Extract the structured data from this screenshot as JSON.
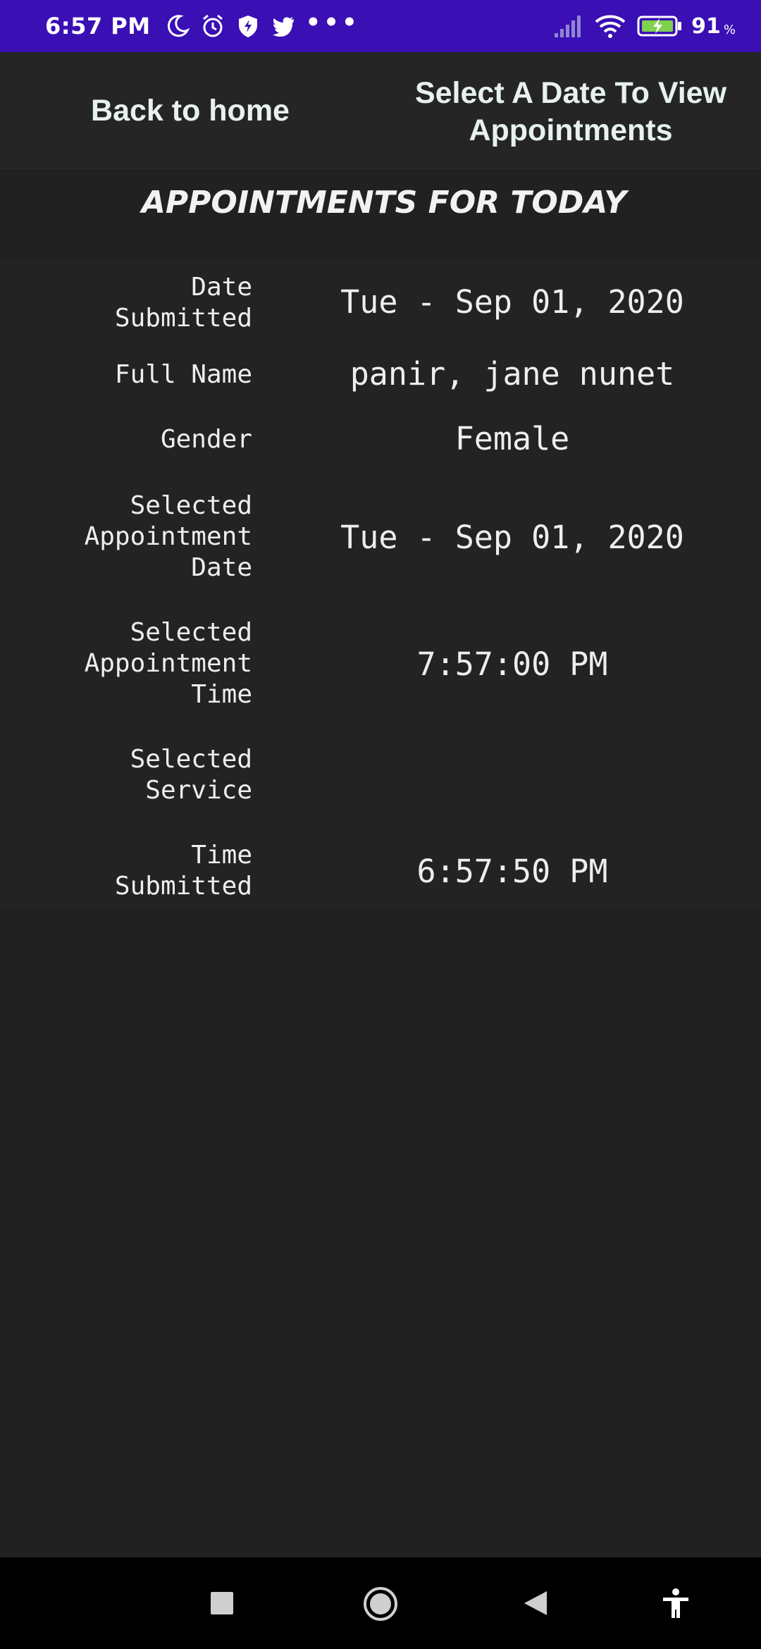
{
  "status_bar": {
    "time": "6:57 PM",
    "left_icons": [
      "moon-icon",
      "alarm-icon",
      "shield-icon",
      "twitter-icon"
    ],
    "more": "•••",
    "battery_level": "91",
    "battery_unit": "%"
  },
  "header": {
    "back_label": "Back to home",
    "select_date_label": "Select A Date To View Appointments"
  },
  "title": "APPOINTMENTS FOR TODAY",
  "details": [
    {
      "label": "Date Submitted",
      "value": "Tue - Sep 01, 2020"
    },
    {
      "label": "Full Name",
      "value": "panir, jane nunet"
    },
    {
      "label": "Gender",
      "value": "Female"
    },
    {
      "label": "Selected Appointment Date",
      "value": "Tue - Sep 01, 2020"
    },
    {
      "label": "Selected Appointment Time",
      "value": "7:57:00 PM"
    },
    {
      "label": "Selected Service",
      "value": ""
    },
    {
      "label": "Time Submitted",
      "value": "6:57:50 PM"
    }
  ],
  "nav": {
    "icons": [
      "recents-square-icon",
      "home-circle-icon",
      "back-triangle-icon",
      "accessibility-icon"
    ]
  },
  "colors": {
    "status_bar_bg": "#3a0fb4",
    "page_bg": "#212121",
    "header_text": "#e7f2ec"
  }
}
